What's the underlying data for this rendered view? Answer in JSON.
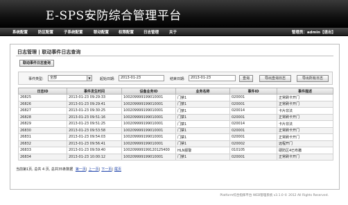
{
  "header": {
    "title": "E-SPS安防综合管理平台"
  },
  "nav": {
    "items": [
      "系统配置",
      "防区配置",
      "子系统配置",
      "联动配置",
      "权限配置",
      "日志管理",
      "关于"
    ],
    "admin": "管理员：admin【退出】"
  },
  "breadcrumb": "日志管理 | 联动事件日志查询",
  "tab_button": "联动事件日志查询",
  "filters": {
    "type_label": "事件类型:",
    "type_value": "全部",
    "start_label": "起始日期:",
    "start_value": "2013-01-23",
    "end_label": "结束日期:",
    "end_value": "2013-01-23",
    "query_button": "查询",
    "export_query_button": "导出查询日志",
    "export_all_button": "导出所有日志"
  },
  "table": {
    "columns": [
      "日志ID",
      "事件发生时间",
      "设备业务ID",
      "业务名称",
      "事件ID",
      "事件描述"
    ],
    "rows": [
      [
        "26825",
        "2013-01-23 09:29:33",
        "100209999199010001",
        "门禁1",
        "020001",
        "正常刷卡开门"
      ],
      [
        "26826",
        "2013-01-23 09:29:41",
        "100209999199010001",
        "门禁1",
        "020001",
        "正常刷卡开门"
      ],
      [
        "26827",
        "2013-01-23 09:30:25",
        "100209999199010001",
        "门禁1",
        "020014",
        "卡片非法"
      ],
      [
        "26828",
        "2013-01-23 09:51:16",
        "100209999199010001",
        "门禁1",
        "020001",
        "正常刷卡开门"
      ],
      [
        "26829",
        "2013-01-23 09:51:25",
        "100209999199010001",
        "门禁1",
        "020014",
        "卡片非法"
      ],
      [
        "26830",
        "2013-01-23 09:53:58",
        "100209999199010001",
        "门禁1",
        "020001",
        "正常刷卡开门"
      ],
      [
        "26831",
        "2013-01-23 09:54:03",
        "100209999199010001",
        "门禁1",
        "020001",
        "正常刷卡开门"
      ],
      [
        "26832",
        "2013-01-23 09:56:41",
        "100209999199010001",
        "门禁1",
        "020002",
        "远程开门"
      ],
      [
        "26833",
        "2013-01-23 09:59:40",
        "100209999199120125400",
        "HLN报警",
        "010105",
        "硬防区4已布撤"
      ],
      [
        "26834",
        "2013-01-23 10:00:12",
        "100209999199010001",
        "门禁1",
        "020001",
        "正常刷卡开门"
      ]
    ]
  },
  "pager": {
    "info": "当前第1页, 总共 4 页, 总共35条数据",
    "first": "第一页",
    "prev": "上一页",
    "next": "下一页",
    "last": "尾页"
  },
  "footer": "Platform综合指挥平台 WEB管理系统 v3.1.0 © 2012 All Rights Reserved."
}
